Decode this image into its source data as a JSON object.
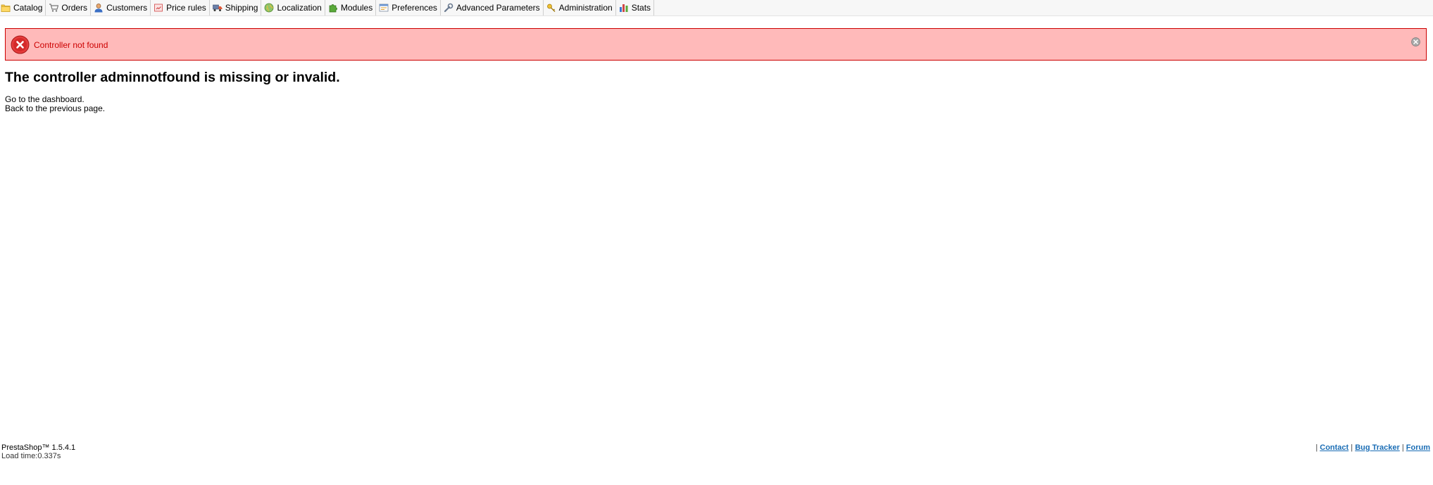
{
  "menu": {
    "items": [
      {
        "label": "Catalog",
        "icon": "folder-icon"
      },
      {
        "label": "Orders",
        "icon": "cart-icon"
      },
      {
        "label": "Customers",
        "icon": "user-icon"
      },
      {
        "label": "Price rules",
        "icon": "price-tag-icon"
      },
      {
        "label": "Shipping",
        "icon": "truck-icon"
      },
      {
        "label": "Localization",
        "icon": "globe-icon"
      },
      {
        "label": "Modules",
        "icon": "puzzle-icon"
      },
      {
        "label": "Preferences",
        "icon": "preferences-icon"
      },
      {
        "label": "Advanced Parameters",
        "icon": "wrench-icon"
      },
      {
        "label": "Administration",
        "icon": "key-icon"
      },
      {
        "label": "Stats",
        "icon": "bar-chart-icon"
      }
    ]
  },
  "error": {
    "message": "Controller not found",
    "colors": {
      "background": "#ffbaba",
      "border": "#cc0000",
      "text": "#cc0000"
    }
  },
  "main": {
    "title": "The controller adminnotfound is missing or invalid.",
    "dashboard_link": "Go to the dashboard.",
    "back_link": "Back to the previous page."
  },
  "footer": {
    "version": "PrestaShop™ 1.5.4.1",
    "load_time": "Load time:0.337s",
    "separator": "|",
    "links": {
      "contact": "Contact",
      "bug_tracker": "Bug Tracker",
      "forum": "Forum"
    },
    "link_color": "#1a6db5"
  }
}
